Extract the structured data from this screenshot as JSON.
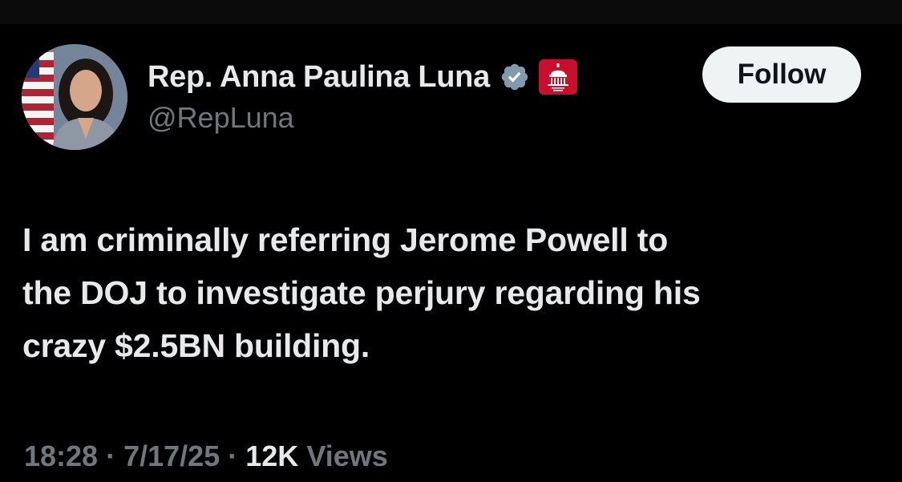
{
  "author": {
    "display_name": "Rep. Anna Paulina Luna",
    "handle": "@RepLuna",
    "verified_icon": "verified-badge-icon",
    "affiliate_badge": "house-gop-badge",
    "avatar_icon": "profile-photo"
  },
  "follow_button": {
    "label": "Follow"
  },
  "tweet": {
    "lines": [
      "I am criminally referring Jerome Powell to",
      "the DOJ to investigate perjury regarding his",
      "crazy $2.5BN building."
    ]
  },
  "meta": {
    "time": "18:28",
    "separator": "·",
    "date": "7/17/25",
    "views_count": "12K",
    "views_label": "Views"
  },
  "colors": {
    "background": "#000000",
    "primary_text": "#e7e9ea",
    "secondary_text": "#71767b",
    "follow_button_bg": "#eff3f4",
    "verified": "#829aab",
    "affiliate_badge": "#c8102e"
  }
}
